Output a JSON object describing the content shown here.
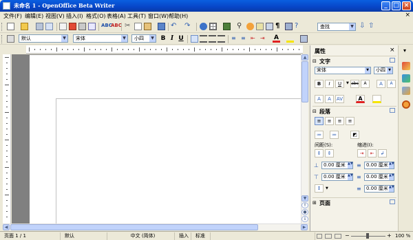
{
  "window": {
    "title": "未命名 1 - OpenOffice Beta Writer",
    "min": "_",
    "max": "□",
    "close": "×"
  },
  "menu": [
    "文件(F)",
    "编辑(E)",
    "视图(V)",
    "插入(I)",
    "格式(O)",
    "表格(A)",
    "工具(T)",
    "窗口(W)",
    "帮助(H)"
  ],
  "menu_close": "×",
  "toolbar": {
    "search_placeholder": "查找"
  },
  "format": {
    "style": "默认",
    "font": "宋体",
    "size": "小四",
    "bold": "B",
    "italic": "I",
    "underline": "U"
  },
  "sidebar": {
    "title": "属性",
    "close": "×",
    "text_section": "文字",
    "font": "宋体",
    "size": "小四",
    "paragraph_section": "段落",
    "spacing_label": "间距(S):",
    "indent_label": "缩进(I):",
    "spin_values": [
      "0.00 厘米",
      "0.00 厘米",
      "0.00 厘米",
      "0.00 厘米",
      "0.00 厘米"
    ],
    "page_section": "页面"
  },
  "status": {
    "page": "页面 1 / 1",
    "style": "默认",
    "language": "中文 (简体)",
    "insert": "插入",
    "selection": "标准",
    "zoom": "100 %"
  },
  "colors": {
    "titlebar": "#0A5FE0",
    "chrome": "#ECE9D8",
    "doc_bg": "#808080",
    "accent_red": "#E02020"
  }
}
